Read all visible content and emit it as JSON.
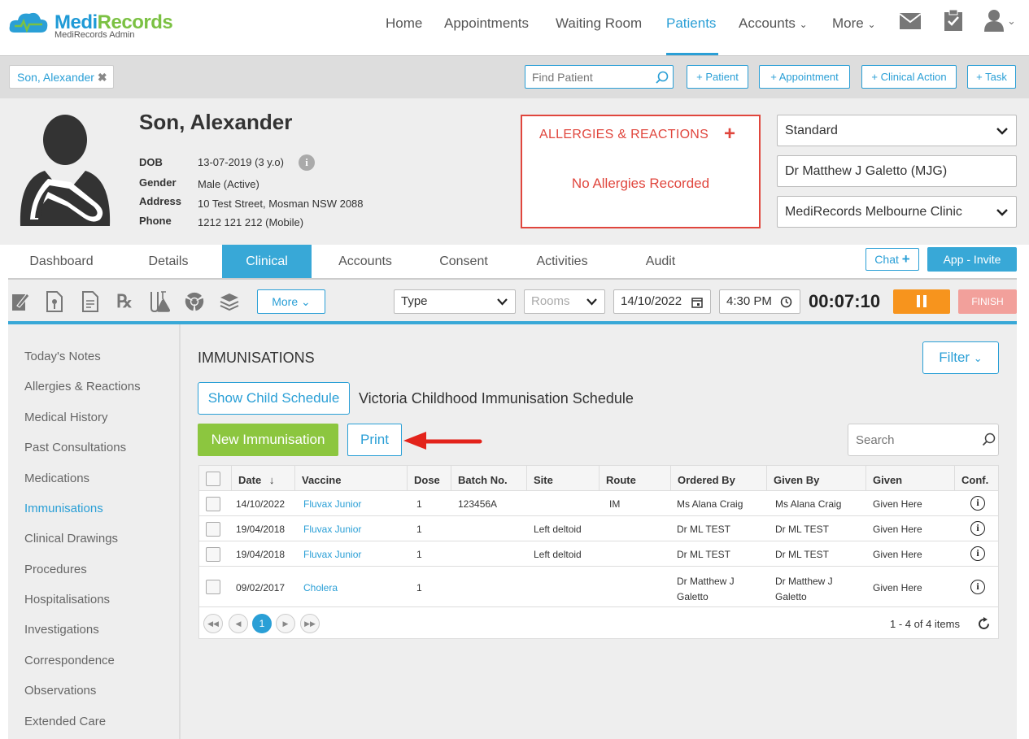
{
  "app": {
    "logo_name_a": "Medi",
    "logo_name_b": "Records",
    "logo_sub": "MediRecords Admin"
  },
  "nav": {
    "home": "Home",
    "appointments": "Appointments",
    "waiting": "Waiting Room",
    "patients": "Patients",
    "accounts": "Accounts",
    "more": "More"
  },
  "bar": {
    "patient_tab": "Son, Alexander",
    "find_placeholder": "Find Patient",
    "add_patient": "+ Patient",
    "add_appointment": "+ Appointment",
    "add_clinical": "+ Clinical Action",
    "add_task": "+ Task"
  },
  "patient": {
    "name": "Son, Alexander",
    "dob_label": "DOB",
    "dob": "13-07-2019 (3 y.o)",
    "gender_label": "Gender",
    "gender": "Male (Active)",
    "address_label": "Address",
    "address": "10 Test Street, Mosman NSW 2088",
    "phone_label": "Phone",
    "phone": "1212 121 212 (Mobile)"
  },
  "allergies": {
    "title": "ALLERGIES & REACTIONS",
    "none": "No Allergies Recorded"
  },
  "selects": {
    "billing": "Standard",
    "doctor": "Dr Matthew J Galetto (MJG)",
    "clinic": "MediRecords Melbourne Clinic"
  },
  "tabs": [
    "Dashboard",
    "Details",
    "Clinical",
    "Accounts",
    "Consent",
    "Activities",
    "Audit"
  ],
  "chat": "Chat",
  "app_invite": "App - Invite",
  "toolbar": {
    "more": "More",
    "type": "Type",
    "rooms": "Rooms",
    "date": "14/10/2022",
    "time": "4:30 PM",
    "timer": "00:07:10",
    "finish": "FINISH"
  },
  "sidebar": [
    "Today's Notes",
    "Allergies & Reactions",
    "Medical History",
    "Past Consultations",
    "Medications",
    "Immunisations",
    "Clinical Drawings",
    "Procedures",
    "Hospitalisations",
    "Investigations",
    "Correspondence",
    "Observations",
    "Extended Care"
  ],
  "section": {
    "title": "IMMUNISATIONS",
    "filter": "Filter",
    "show_schedule": "Show Child Schedule",
    "schedule_name": "Victoria Childhood Immunisation Schedule",
    "new": "New Immunisation",
    "print": "Print",
    "search_placeholder": "Search"
  },
  "table": {
    "headers": [
      "Date",
      "Vaccine",
      "Dose",
      "Batch No.",
      "Site",
      "Route",
      "Ordered By",
      "Given By",
      "Given",
      "Conf."
    ],
    "rows": [
      [
        "14/10/2022",
        "Fluvax Junior",
        "1",
        "123456A",
        "",
        "IM",
        "Ms Alana Craig",
        "Ms Alana Craig",
        "Given Here"
      ],
      [
        "19/04/2018",
        "Fluvax Junior",
        "1",
        "",
        "Left deltoid",
        "",
        "Dr ML TEST",
        "Dr ML TEST",
        "Given Here"
      ],
      [
        "19/04/2018",
        "Fluvax Junior",
        "1",
        "",
        "Left deltoid",
        "",
        "Dr ML TEST",
        "Dr ML TEST",
        "Given Here"
      ],
      [
        "09/02/2017",
        "Cholera",
        "1",
        "",
        "",
        "",
        "Dr Matthew J Galetto",
        "Dr Matthew J Galetto",
        "Given Here"
      ]
    ],
    "ordered_lines": [
      "Dr Matthew J",
      "Galetto"
    ],
    "page": "1",
    "items": "1 - 4 of 4 items"
  },
  "colors": {
    "accent": "#2a9fd6",
    "green": "#7bc143",
    "alert": "#e0463d",
    "pause": "#f7941d",
    "finish": "#f2a09b"
  }
}
